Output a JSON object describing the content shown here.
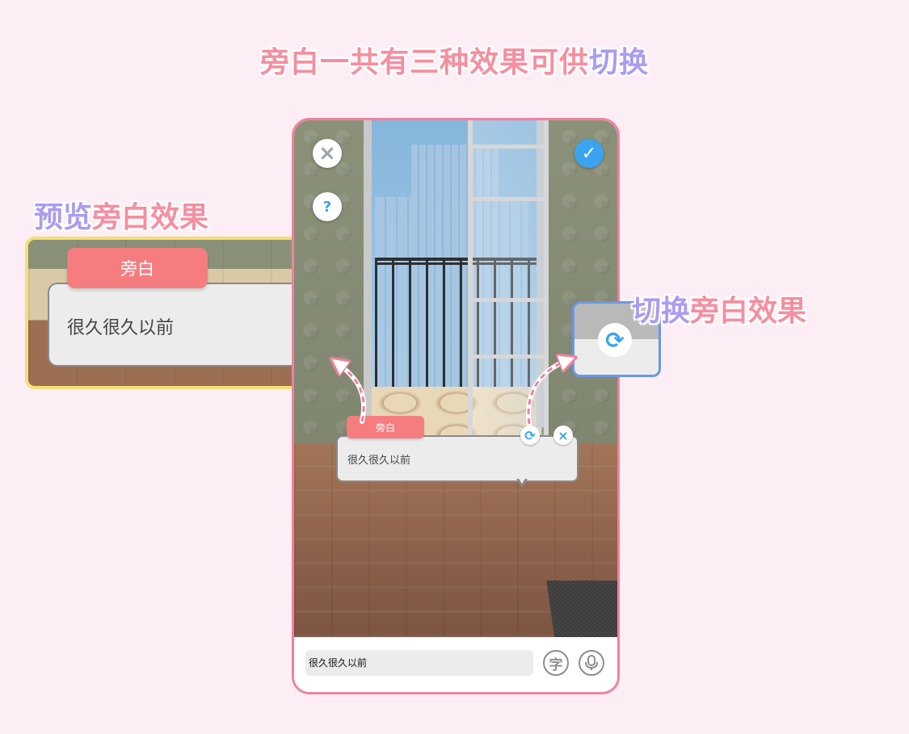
{
  "title": {
    "part1": "旁白一共有三种效果可供",
    "part2": "切换"
  },
  "callouts": {
    "preview": {
      "prefix": "预览",
      "rest": "旁白效果"
    },
    "switch": {
      "prefix": "切换",
      "rest": "旁白效果"
    }
  },
  "preview_box": {
    "tab_label": "旁白",
    "text": "很久很久以前"
  },
  "phone": {
    "narration": {
      "label": "旁白",
      "text": "很久很久以前"
    },
    "input": {
      "value": "很久很久以前"
    },
    "icons": {
      "close": "×",
      "check": "✓",
      "help": "?",
      "swap": "⟳",
      "char": "字",
      "mic": "🎙"
    }
  },
  "colors": {
    "accent_pink": "#f58fa0",
    "accent_purple": "#a99cf0",
    "label_red": "#f57d80",
    "button_blue": "#3ba4f0",
    "preview_border": "#f5df75",
    "switch_border": "#6a98e6",
    "phone_border": "#f0829c"
  }
}
